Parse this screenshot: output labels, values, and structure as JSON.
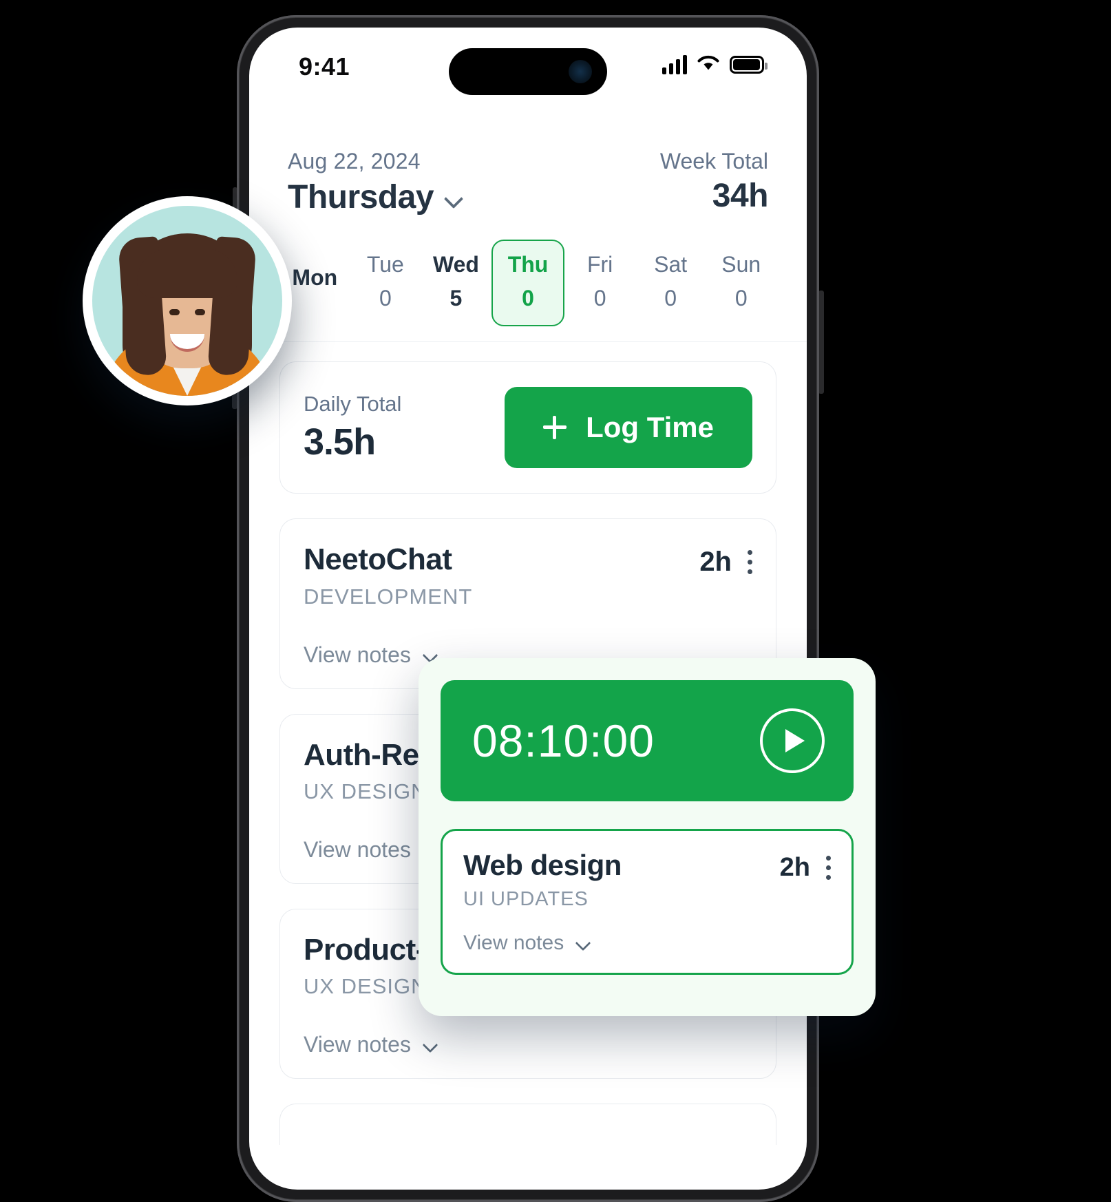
{
  "status_bar": {
    "time": "9:41",
    "signal_icon": "cellular-signal-icon",
    "wifi_icon": "wifi-icon",
    "battery_icon": "battery-icon"
  },
  "header": {
    "date": "Aug 22, 2024",
    "day_name": "Thursday",
    "day_dropdown_icon": "chevron-down-icon",
    "week_total_label": "Week Total",
    "week_total_value": "34h"
  },
  "week_strip": {
    "days": [
      {
        "name": "Mon",
        "value": "",
        "state": "bold"
      },
      {
        "name": "Tue",
        "value": "0",
        "state": "normal"
      },
      {
        "name": "Wed",
        "value": "5",
        "state": "bold"
      },
      {
        "name": "Thu",
        "value": "0",
        "state": "active"
      },
      {
        "name": "Fri",
        "value": "0",
        "state": "normal"
      },
      {
        "name": "Sat",
        "value": "0",
        "state": "normal"
      },
      {
        "name": "Sun",
        "value": "0",
        "state": "normal"
      }
    ]
  },
  "daily_card": {
    "label": "Daily Total",
    "value": "3.5h",
    "log_time_label": "Log Time",
    "log_time_icon": "plus-icon"
  },
  "tasks": [
    {
      "title": "NeetoChat",
      "category": "DEVELOPMENT",
      "hours": "2h",
      "notes_label": "View notes",
      "menu_icon": "kebab-menu-icon",
      "notes_icon": "chevron-down-icon"
    },
    {
      "title": "Auth-Research",
      "category": "UX DESIGN",
      "hours": "",
      "notes_label": "View notes",
      "menu_icon": "kebab-menu-icon",
      "notes_icon": "chevron-down-icon"
    },
    {
      "title": "Product-Research",
      "category": "UX DESIGN",
      "hours": "",
      "notes_label": "View notes",
      "menu_icon": "kebab-menu-icon",
      "notes_icon": "chevron-down-icon"
    }
  ],
  "timer_panel": {
    "elapsed": "08:10:00",
    "play_icon": "play-icon",
    "task": {
      "title": "Web design",
      "category": "UI UPDATES",
      "hours": "2h",
      "notes_label": "View notes",
      "menu_icon": "kebab-menu-icon",
      "notes_icon": "chevron-down-icon"
    }
  },
  "avatar": {
    "alt": "user-avatar"
  },
  "colors": {
    "brand_green": "#13a44a",
    "active_day_bg": "#eafaef",
    "panel_bg": "#f3fcf4",
    "text_dark": "#1d2b39",
    "text_muted": "#64748b",
    "page_bg": "#000000"
  }
}
